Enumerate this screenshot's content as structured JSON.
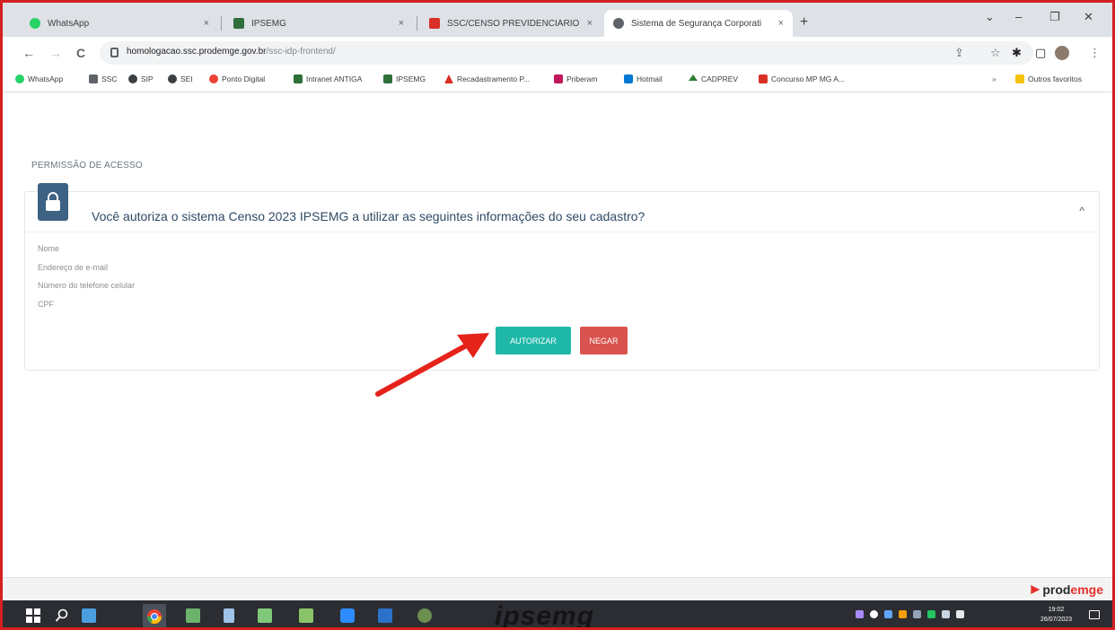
{
  "browser": {
    "tabs": [
      {
        "label": "WhatsApp",
        "active": false,
        "color": "#25d366"
      },
      {
        "label": "IPSEMG",
        "active": false,
        "color": "#2f6f3a"
      },
      {
        "label": "SSC/CENSO PREVIDENCIÁRIO",
        "active": false,
        "color": "#d93025"
      },
      {
        "label": "Sistema de Segurança Corporati",
        "active": true,
        "color": "#5f6368"
      }
    ],
    "tab_close": "×",
    "new_tab": "+",
    "window_controls": {
      "menu": "⌄",
      "minimize": "–",
      "restore": "❐",
      "close": "✕"
    },
    "nav": {
      "back": "←",
      "forward": "→",
      "reload": "C"
    },
    "url_host": "homologacao.ssc.prodemge.gov.br",
    "url_path": "/ssc-idp-frontend/",
    "toolbar_icons": {
      "share": "⇪",
      "star": "☆",
      "extensions": "✱",
      "sidepanel": "▢",
      "menu": "⋮"
    },
    "bookmarks": [
      {
        "label": "WhatsApp",
        "color": "#25d366"
      },
      {
        "label": "SSC",
        "color": "#5f6368"
      },
      {
        "label": "SIP",
        "color": "#3c4043"
      },
      {
        "label": "SEI",
        "color": "#3c4043"
      },
      {
        "label": "Ponto Digital",
        "color": "#ea4335"
      },
      {
        "label": "Intranet ANTIGA",
        "color": "#2f6f3a"
      },
      {
        "label": "IPSEMG",
        "color": "#2f6f3a"
      },
      {
        "label": "Recadastramento P...",
        "color": "#d93025"
      },
      {
        "label": "Priberam",
        "color": "#c2185b"
      },
      {
        "label": "Hotmail",
        "color": "#0078d4"
      },
      {
        "label": "CADPREV",
        "color": "#2e7d32"
      },
      {
        "label": "Concurso MP MG A...",
        "color": "#d93025"
      }
    ],
    "other_bookmarks": "Outros favoritos",
    "overflow": "»"
  },
  "page": {
    "section_title": "PERMISSÃO DE ACESSO",
    "question": "Você autoriza o sistema Censo 2023 IPSEMG a utilizar as seguintes informações do seu cadastro?",
    "collapse_icon": "^",
    "fields": [
      "Nome",
      "Endereço de e-mail",
      "Número do telefone celular",
      "CPF"
    ],
    "authorize_label": "AUTORIZAR",
    "deny_label": "NEGAR",
    "brand_prefix": "prod",
    "brand_suffix": "emge"
  },
  "taskbar": {
    "watermark": "ipsemg",
    "time": "19:02",
    "date": "26/07/2023"
  },
  "colors": {
    "accent_frame": "#d32121",
    "authorize": "#1fb8a8",
    "deny": "#d9534f",
    "lock_box": "#3d6283",
    "arrow": "#e5231b"
  }
}
